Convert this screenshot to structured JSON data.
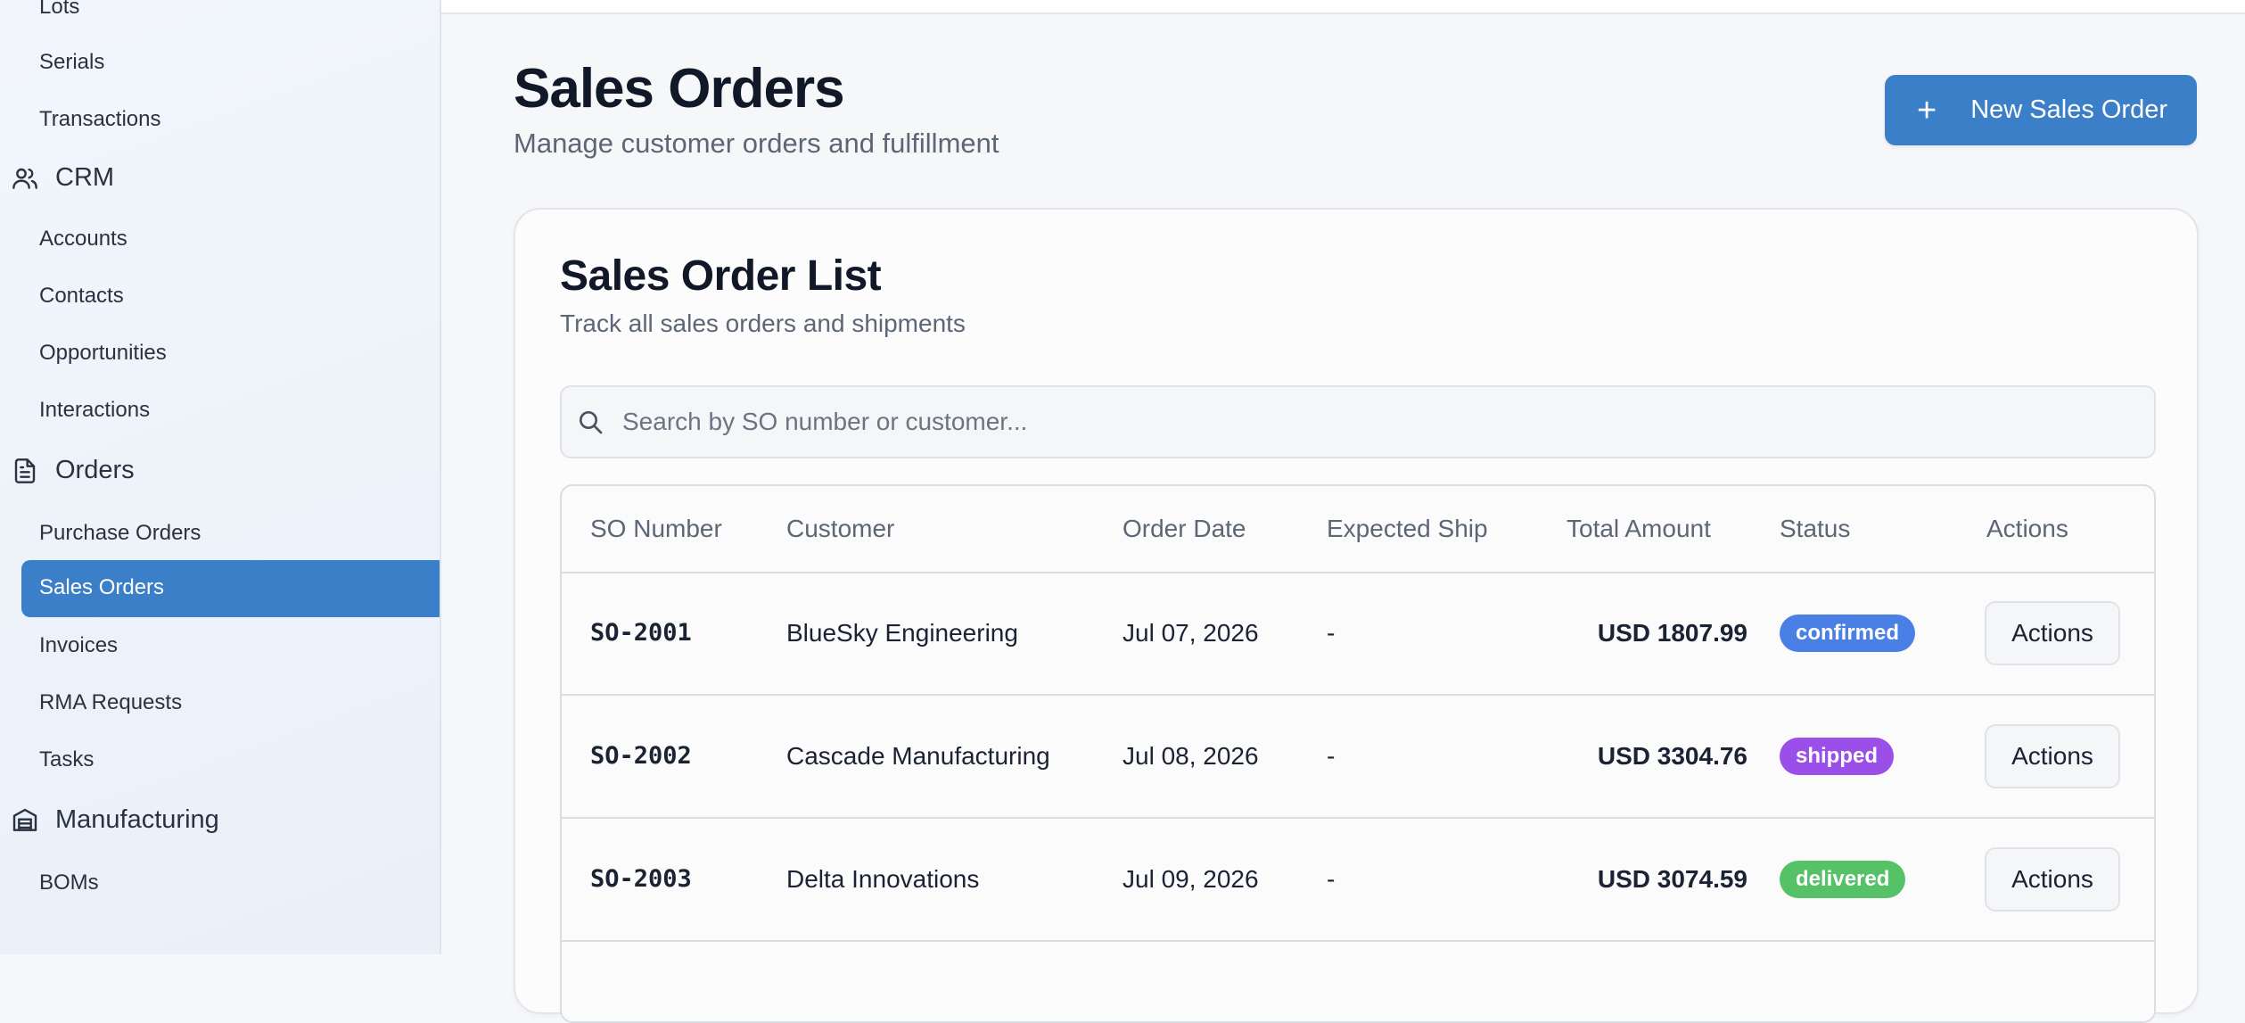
{
  "sidebar": {
    "items": [
      {
        "type": "sub",
        "label": "Lots"
      },
      {
        "type": "sub",
        "label": "Serials"
      },
      {
        "type": "sub",
        "label": "Transactions"
      },
      {
        "type": "section",
        "label": "CRM",
        "icon": "users-icon"
      },
      {
        "type": "sub",
        "label": "Accounts"
      },
      {
        "type": "sub",
        "label": "Contacts"
      },
      {
        "type": "sub",
        "label": "Opportunities"
      },
      {
        "type": "sub",
        "label": "Interactions"
      },
      {
        "type": "section",
        "label": "Orders",
        "icon": "document-icon"
      },
      {
        "type": "sub",
        "label": "Purchase Orders"
      },
      {
        "type": "sub",
        "label": "Sales Orders",
        "active": true
      },
      {
        "type": "sub",
        "label": "Invoices"
      },
      {
        "type": "sub",
        "label": "RMA Requests"
      },
      {
        "type": "sub",
        "label": "Tasks"
      },
      {
        "type": "section",
        "label": "Manufacturing",
        "icon": "factory-icon"
      },
      {
        "type": "sub",
        "label": "BOMs"
      }
    ]
  },
  "header": {
    "title": "Sales Orders",
    "subtitle": "Manage customer orders and fulfillment",
    "new_button": "New Sales Order"
  },
  "card": {
    "title": "Sales Order List",
    "subtitle": "Track all sales orders and shipments",
    "search_placeholder": "Search by SO number or customer..."
  },
  "table": {
    "columns": [
      "SO Number",
      "Customer",
      "Order Date",
      "Expected Ship",
      "Total Amount",
      "Status",
      "Actions"
    ],
    "rows": [
      {
        "so": "SO-2001",
        "customer": "BlueSky Engineering",
        "order_date": "Jul 07, 2026",
        "expected_ship": "-",
        "total": "USD 1807.99",
        "status": "confirmed",
        "action": "Actions"
      },
      {
        "so": "SO-2002",
        "customer": "Cascade Manufacturing",
        "order_date": "Jul 08, 2026",
        "expected_ship": "-",
        "total": "USD 3304.76",
        "status": "shipped",
        "action": "Actions"
      },
      {
        "so": "SO-2003",
        "customer": "Delta Innovations",
        "order_date": "Jul 09, 2026",
        "expected_ship": "-",
        "total": "USD 3074.59",
        "status": "delivered",
        "action": "Actions"
      }
    ]
  },
  "colors": {
    "accent": "#3a7fc8",
    "status_confirmed": "#4a80e6",
    "status_shipped": "#9a4fe8",
    "status_delivered": "#55c267"
  }
}
